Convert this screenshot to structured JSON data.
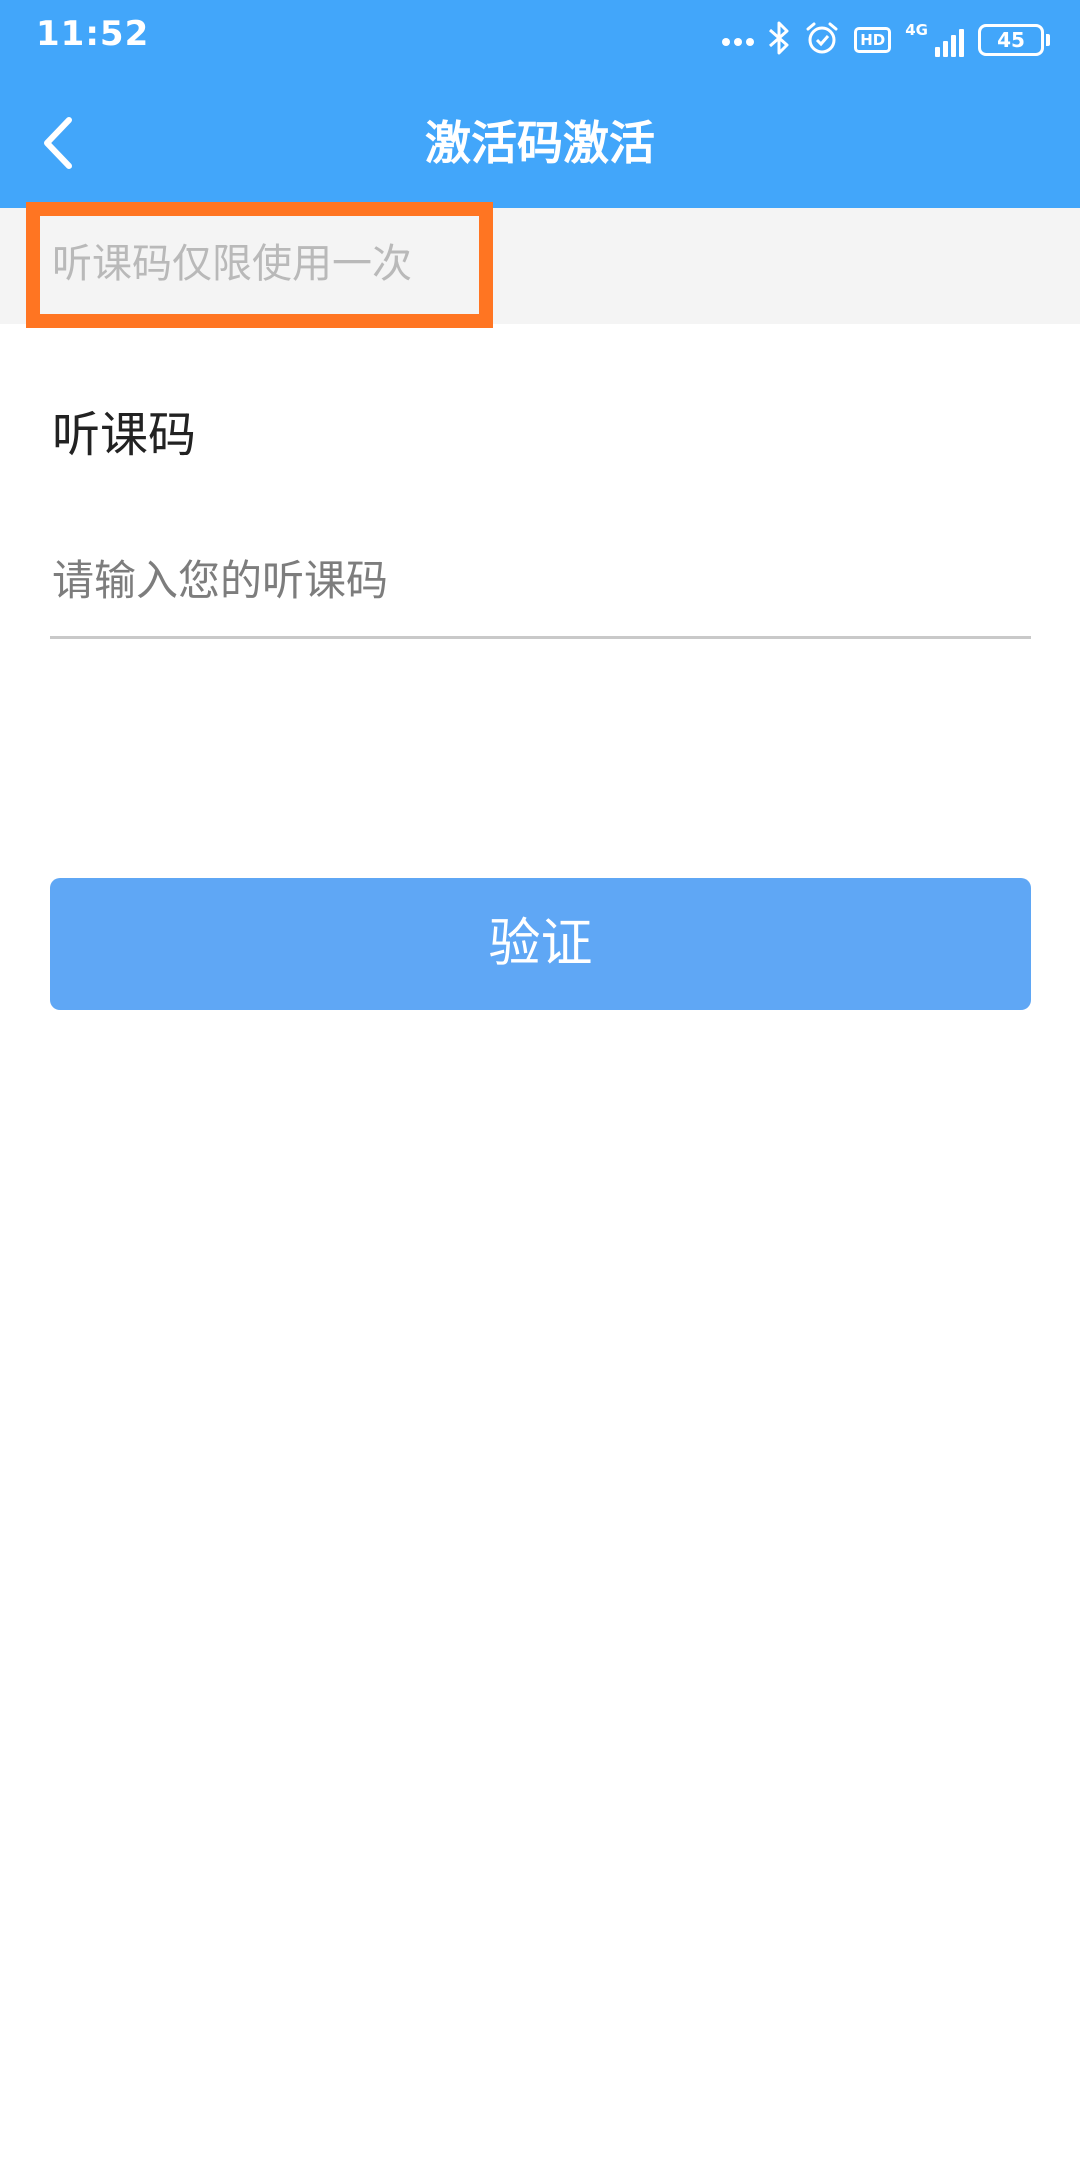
{
  "status_bar": {
    "time": "11:52",
    "network": "4G",
    "hd": "HD",
    "battery": "45",
    "icons": [
      "more-dots-icon",
      "bluetooth-icon",
      "alarm-icon",
      "hd-icon",
      "signal-icon",
      "battery-icon"
    ]
  },
  "header": {
    "back_icon": "chevron-left-icon",
    "title": "激活码激活"
  },
  "notice": {
    "text": "听课码仅限使用一次"
  },
  "form": {
    "label": "听课码",
    "input_value": "",
    "input_placeholder": "请输入您的听课码",
    "submit_label": "验证"
  },
  "colors": {
    "header_bg": "#42a6fa",
    "button_bg": "#5fa7f5",
    "highlight_border": "#ff7522",
    "notice_bg": "#f4f4f4"
  }
}
